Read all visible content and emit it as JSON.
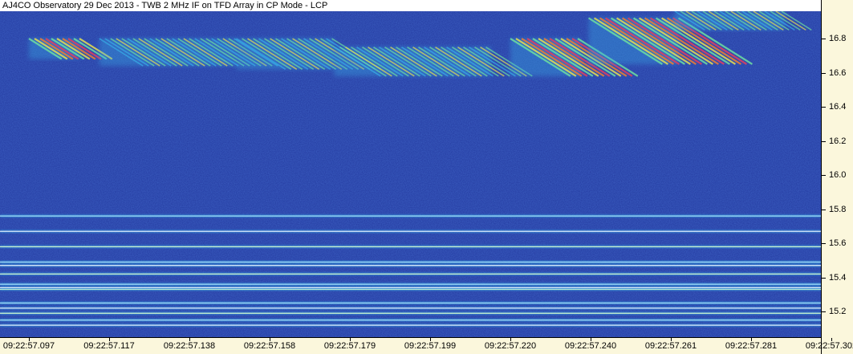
{
  "header": {
    "title": "AJ4CO Observatory 29 Dec 2013 - TWB 2 MHz IF on TFD Array in CP Mode - LCP"
  },
  "chart_data": {
    "type": "heatmap",
    "title": "AJ4CO Observatory 29 Dec 2013 - TWB 2 MHz IF on TFD Array in CP Mode - LCP",
    "xlabel": "",
    "ylabel": "",
    "x_ticks": [
      "09:22:57.097",
      "09:22:57.117",
      "09:22:57.138",
      "09:22:57.158",
      "09:22:57.179",
      "09:22:57.199",
      "09:22:57.220",
      "09:22:57.240",
      "09:22:57.261",
      "09:22:57.281",
      "09:22:57.302"
    ],
    "y_ticks": [
      "15.2",
      "15.4",
      "15.6",
      "15.8",
      "16.0",
      "16.2",
      "16.4",
      "16.6",
      "16.8"
    ],
    "ylim": [
      15.05,
      16.96
    ],
    "y_unit_note": "frequency",
    "grid": false,
    "colormap": [
      "#1a2f9a",
      "#2a5fd0",
      "#38b0e8",
      "#6ee0a0",
      "#e8e050",
      "#f08030",
      "#e04060"
    ],
    "background_color": "#22389e",
    "interference_lines_y": [
      15.12,
      15.15,
      15.19,
      15.22,
      15.25,
      15.33,
      15.34,
      15.36,
      15.42,
      15.47,
      15.49,
      15.58,
      15.67,
      15.76
    ],
    "burst_regions": [
      {
        "x_start": "09:22:57.097",
        "x_end": "09:22:57.110",
        "y_low": 16.68,
        "y_high": 16.8,
        "intensity": "high"
      },
      {
        "x_start": "09:22:57.115",
        "x_end": "09:22:57.150",
        "y_low": 16.64,
        "y_high": 16.8,
        "intensity": "medium"
      },
      {
        "x_start": "09:22:57.150",
        "x_end": "09:22:57.175",
        "y_low": 16.62,
        "y_high": 16.8,
        "intensity": "medium"
      },
      {
        "x_start": "09:22:57.175",
        "x_end": "09:22:57.215",
        "y_low": 16.58,
        "y_high": 16.75,
        "intensity": "medium"
      },
      {
        "x_start": "09:22:57.220",
        "x_end": "09:22:57.238",
        "y_low": 16.58,
        "y_high": 16.8,
        "intensity": "high"
      },
      {
        "x_start": "09:22:57.240",
        "x_end": "09:22:57.263",
        "y_low": 16.65,
        "y_high": 16.92,
        "intensity": "high"
      },
      {
        "x_start": "09:22:57.262",
        "x_end": "09:22:57.290",
        "y_low": 16.85,
        "y_high": 16.96,
        "intensity": "medium"
      }
    ]
  }
}
